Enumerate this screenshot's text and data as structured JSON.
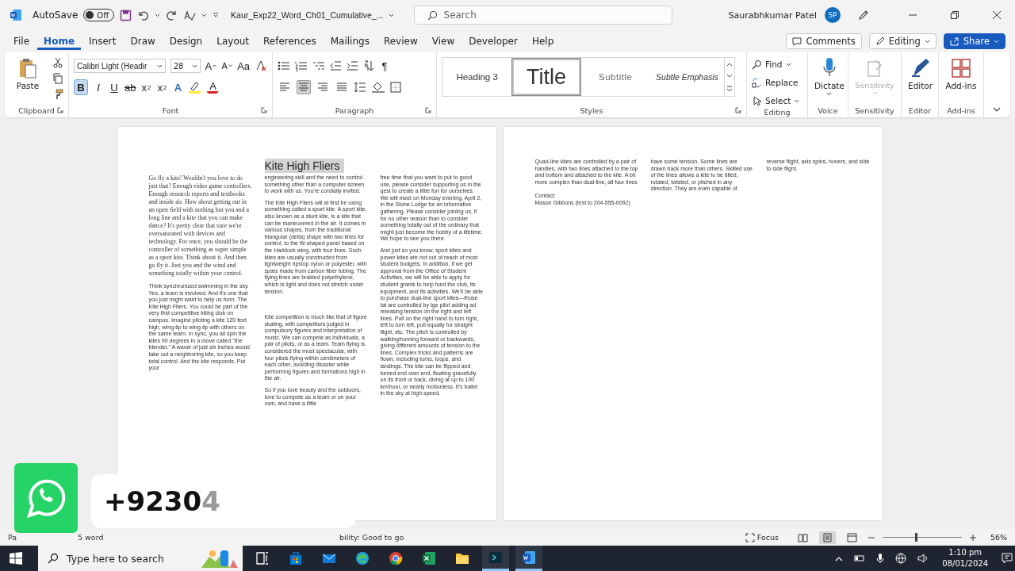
{
  "window": {
    "autosave_label": "AutoSave",
    "autosave": {
      "on": false,
      "label": "Off"
    },
    "title": "Kaur_Exp22_Word_Ch01_Cumulative_...",
    "search_placeholder": "Search",
    "user": "Saurabhkumar Patel",
    "avatar": "SP"
  },
  "tabs": [
    {
      "label": "File",
      "selected": false
    },
    {
      "label": "Home",
      "selected": true
    },
    {
      "label": "Insert",
      "selected": false
    },
    {
      "label": "Draw",
      "selected": false
    },
    {
      "label": "Design",
      "selected": false
    },
    {
      "label": "Layout",
      "selected": false
    },
    {
      "label": "References",
      "selected": false
    },
    {
      "label": "Mailings",
      "selected": false
    },
    {
      "label": "Review",
      "selected": false
    },
    {
      "label": "View",
      "selected": false
    },
    {
      "label": "Developer",
      "selected": false
    },
    {
      "label": "Help",
      "selected": false
    }
  ],
  "tab_actions": {
    "comments": "Comments",
    "editing": "Editing",
    "share": "Share"
  },
  "ribbon": {
    "clipboard": {
      "paste": "Paste",
      "label": "Clipboard"
    },
    "font": {
      "name": "Calibri Light (Headir",
      "size": "28",
      "label": "Font",
      "row1": [
        {
          "kind": "grow",
          "text": "A"
        },
        {
          "kind": "shrink",
          "text": "A"
        },
        {
          "kind": "case",
          "text": "Aa"
        }
      ],
      "row2": [
        {
          "kind": "bold",
          "text": "B",
          "on": true
        },
        {
          "kind": "italic",
          "text": "I",
          "on": false
        },
        {
          "kind": "underline",
          "text": "U",
          "on": false
        },
        {
          "kind": "strike",
          "text": "ab",
          "on": false
        },
        {
          "kind": "sub",
          "text": "x",
          "index": "2",
          "on": false
        },
        {
          "kind": "sup",
          "text": "x",
          "index": "2",
          "on": false
        }
      ],
      "effects_label": "A",
      "font_color_label": "A"
    },
    "paragraph": {
      "label": "Paragraph",
      "pilcrow": "¶",
      "alignments": [
        {
          "kind": "left",
          "selected": false
        },
        {
          "kind": "center",
          "selected": true
        },
        {
          "kind": "right",
          "selected": false
        },
        {
          "kind": "justify",
          "selected": false
        }
      ]
    },
    "styles": {
      "label": "Styles",
      "items": [
        {
          "kind": "heading",
          "label": "Heading 3",
          "selected": false
        },
        {
          "kind": "title",
          "label": "Title",
          "selected": true
        },
        {
          "kind": "subtitle",
          "label": "Subtitle",
          "selected": false
        },
        {
          "kind": "emphasis",
          "label": "Subtle Emphasis",
          "selected": false
        }
      ]
    },
    "editing": {
      "label": "Editing",
      "find": "Find",
      "replace": "Replace",
      "select": "Select"
    },
    "groups": [
      {
        "kind": "voice",
        "button": "Dictate",
        "label": "Voice",
        "disabled": false
      },
      {
        "kind": "sensitivity",
        "button": "Sensitivity",
        "label": "Sensitivity",
        "disabled": true
      },
      {
        "kind": "editor",
        "button": "Editor",
        "label": "Editor",
        "disabled": false
      },
      {
        "kind": "addins",
        "button": "Add-ins",
        "label": "Add-ins",
        "disabled": false
      }
    ]
  },
  "document": {
    "page1": {
      "title": "Kite High Fliers",
      "columns": [
        [
          {
            "kind": "serif",
            "text": "Go fly a kite! Wouldn't you love to do just that? Enough video game controllers. Enough research reports and textbooks and inside air. How about getting out in an open field with nothing but you and a long line and a kite that you can make dance? It's pretty clear that sure we're oversaturated with devices and technology. For once, you should be the controller of something as super simple as a sport kite. Think about it. And then go fly it. Just you and the wind and something totally within your control."
          },
          {
            "kind": "sans",
            "text": "Think synchronized swimming in the sky. Yes, a team is involved. And it's one that you just might want to help us form. The Kite High Fliers. You could be part of the very first competitive kiting club on campus. Imagine piloting a kite 120 feet high, wing-tip to wing-tip with others on the same team. In sync, you all spin the kites 90 degrees in a move called \"the blender.\" A waver of just six inches would take out a neighboring kite, so you keep total control. And the kite responds. Put your"
          }
        ],
        [
          {
            "kind": "sans",
            "text": "engineering skill and the need to control something other than a computer screen to work with us. You're cordially invited."
          },
          {
            "kind": "sans",
            "text": "The Kite High Fliers will at first be using something called a sport kite. A sport kite, also known as a stunt kite, is a kite that can be maneuvered in the air. It comes in various shapes, from the traditional triangular (delta) shape with two lines for control, to the W-shaped panel based on the Haddock wing, with four lines. Such kites are usually constructed from lightweight ripstop nylon or polyester, with spars made from carbon fiber tubing. The flying lines are braided polyethylene, which is light and does not stretch under tension."
          },
          {
            "kind": "spaced",
            "text": "Kite competition is much like that of figure skating, with competitors judged in compulsory figures and interpretation of music. We can compete as individuals, a pair of pilots, or as a team. Team flying is considered the most spectacular, with four pilots flying within centimeters of each other, avoiding disaster while performing figures and formations high in the air."
          },
          {
            "kind": "sans",
            "text": "So if you love beauty and the outdoors, love to compete as a team or on your own, and have a little"
          }
        ],
        [
          {
            "kind": "sans",
            "text": "free time that you want to put to good use, please consider supporting us in the qest to create a little fun for ourselves. We will meet on Monday evening, April 2, in the Stone Lodge for an informative gathering. Please consider joining us, if for no other reason than to consider something totally out of the ordinary that might just become the hobby of a lifetime. We hope to see you there."
          },
          {
            "kind": "sans",
            "text": "And just so you know, sport kites and power kites are not out of reach of most student budgets. In addition, if we get approval from the Office of Student Activities, we will be able to apply for student grants to help fund the club, its equipment, and its activities. We'll be able to purchase dual-line sport kites—those tat are controlled by tge pilot adding ad releasing tension on the right and left lines. Pull on the right hand to turn right, left to turn left, pull equally for straight flight, etc. The pitch is controlled by walking/running forward or backwards, giving different amounts of tension to the lines. Complex tricks and patterns are flown, including turns, loops, and landings. The kite can be flipped and turned end over end, floating gracefully on its front or back, diving at up to 100 km/hour, or nearly motionless. It's ballet in the sky at high speed."
          }
        ]
      ]
    },
    "page2": {
      "columns": [
        [
          {
            "kind": "sans",
            "text": "Quad-line kites are controlled by a pair of handles, with two lines attached to the top and bottom and attached to the kite. A bit more complex than dual-line, all four lines"
          }
        ],
        [
          {
            "kind": "sans",
            "text": "have some tension. Some lines are drawn back more than others. Skilled use of the lines allows a kite to be tilted, rotated, twisted, or pitched in any direction. They are even capable of"
          }
        ],
        [
          {
            "kind": "sans",
            "text": "reverse flight, axis spins, hovers, and side to side flight."
          }
        ]
      ],
      "contact": [
        "Contact:",
        "Mason Gibbons (text to 204-555-0092)"
      ]
    }
  },
  "status_bar": {
    "left": [
      "Pa",
      "5 word",
      "bility: Good to go"
    ],
    "focus": "Focus",
    "views": [
      {
        "kind": "read",
        "selected": false
      },
      {
        "kind": "print",
        "selected": true
      },
      {
        "kind": "web",
        "selected": false
      }
    ],
    "zoom": {
      "level": 0.42,
      "reading": "56%"
    }
  },
  "overlay": {
    "text": "+9230",
    "faded_text": "4"
  },
  "taskbar": {
    "search_placeholder": "Type here to search",
    "apps": [
      {
        "kind": "taskview",
        "active": false
      },
      {
        "kind": "store",
        "active": false
      },
      {
        "kind": "mail",
        "active": false
      },
      {
        "kind": "edge",
        "active": false
      },
      {
        "kind": "chrome",
        "active": false
      },
      {
        "kind": "excel",
        "active": false
      },
      {
        "kind": "explorer",
        "active": false
      },
      {
        "kind": "terminal",
        "active": true
      },
      {
        "kind": "word",
        "active": true
      }
    ],
    "time": "1:10 pm",
    "date": "08/01/2024"
  }
}
